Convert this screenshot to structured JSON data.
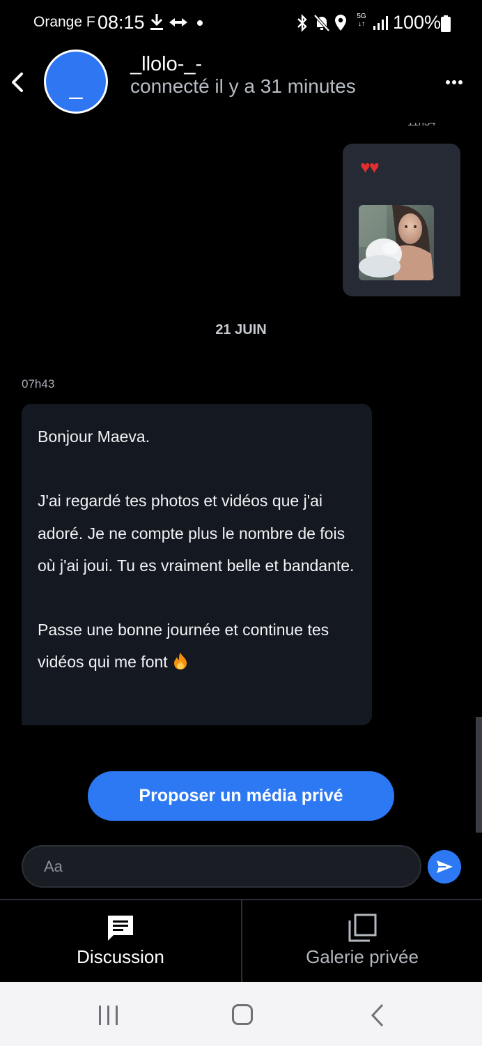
{
  "status_bar": {
    "carrier": "Orange F",
    "time": "08:15",
    "network": "5G",
    "battery": "100%"
  },
  "header": {
    "avatar_letter": "_",
    "contact_name": "_llolo-_-",
    "contact_status": "connecté il y a 31 minutes"
  },
  "conversation": {
    "sent_message": {
      "text": "♥♥"
    },
    "date_separator": "21 JUIN",
    "received_message": {
      "time": "07h43",
      "text": "Bonjour Maeva.\n\nJ'ai regardé tes photos et vidéos que j'ai adoré. Je ne compte plus le nombre de fois où j'ai joui. Tu es vraiment belle et bandante.\n\nPasse une bonne journée et continue tes vidéos qui me font"
    }
  },
  "actions": {
    "propose_media_label": "Proposer un média privé"
  },
  "composer": {
    "placeholder": "Aa"
  },
  "tabs": [
    {
      "label": "Discussion",
      "icon": "chat-icon",
      "active": true
    },
    {
      "label": "Galerie privée",
      "icon": "gallery-icon",
      "active": false
    }
  ],
  "colors": {
    "accent": "#2d79f4",
    "background": "#000000",
    "sent_bubble": "#252a34",
    "received_bubble": "#141820"
  }
}
